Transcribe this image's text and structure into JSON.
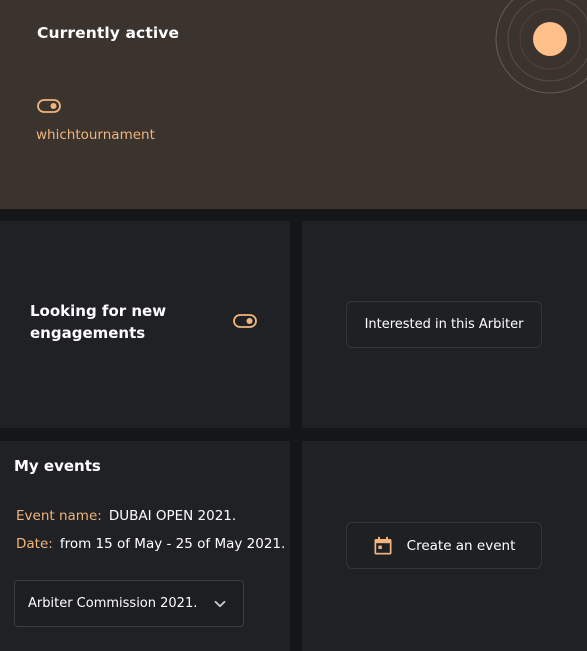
{
  "status": {
    "title": "Currently active",
    "tournament_link": "whichtournament"
  },
  "engagement": {
    "label": "Looking for new engagements",
    "interest_button": "Interested in this Arbiter"
  },
  "events": {
    "title": "My events",
    "event_name_label": "Event name:",
    "event_name_value": "DUBAI OPEN 2021.",
    "date_label": "Date:",
    "date_value": "from 15 of May - 25 of May 2021.",
    "selected_commission": "Arbiter Commission 2021.",
    "create_button": "Create an event"
  },
  "icons": {
    "toggle": "toggle-icon",
    "calendar": "calendar-icon",
    "chevron": "chevron-down-icon"
  },
  "colors": {
    "accent": "#f0b47c",
    "hero_background": "#3a332e",
    "panel_background": "#202124",
    "page_background": "#151618"
  }
}
